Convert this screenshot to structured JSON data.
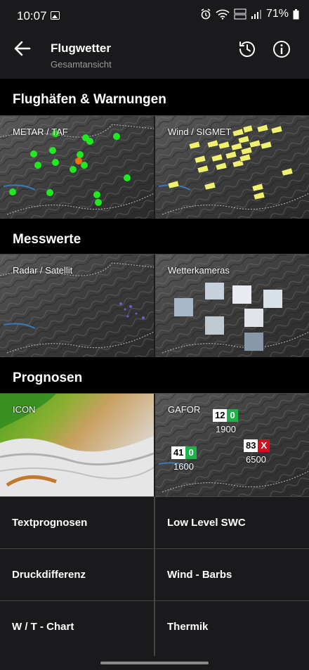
{
  "status": {
    "time": "10:07",
    "battery": "71%"
  },
  "app_bar": {
    "title": "Flugwetter",
    "subtitle": "Gesamtansicht"
  },
  "sections": {
    "airports": {
      "title": "Flughäfen & Warnungen",
      "left": "METAR / TAF",
      "right": "Wind / SIGMET"
    },
    "measurements": {
      "title": "Messwerte",
      "left": "Radar / Satellit",
      "right": "Wetterkameras"
    },
    "forecasts": {
      "title": "Prognosen",
      "left": "ICON",
      "right": "GAFOR"
    }
  },
  "gafor": [
    {
      "num": "12",
      "code": "0",
      "alt": "1900",
      "status": "green"
    },
    {
      "num": "41",
      "code": "0",
      "alt": "1600",
      "status": "green"
    },
    {
      "num": "83",
      "code": "X",
      "alt": "6500",
      "status": "red"
    }
  ],
  "grid": [
    [
      "Textprognosen",
      "Low Level SWC"
    ],
    [
      "Druckdifferenz",
      "Wind - Barbs"
    ],
    [
      "W / T - Chart",
      "Thermik"
    ]
  ],
  "colors": {
    "green": "#1fb24a",
    "red": "#d0101e",
    "metar_green": "#22e822",
    "metar_orange": "#f07010",
    "windsock": "#f0f070"
  }
}
